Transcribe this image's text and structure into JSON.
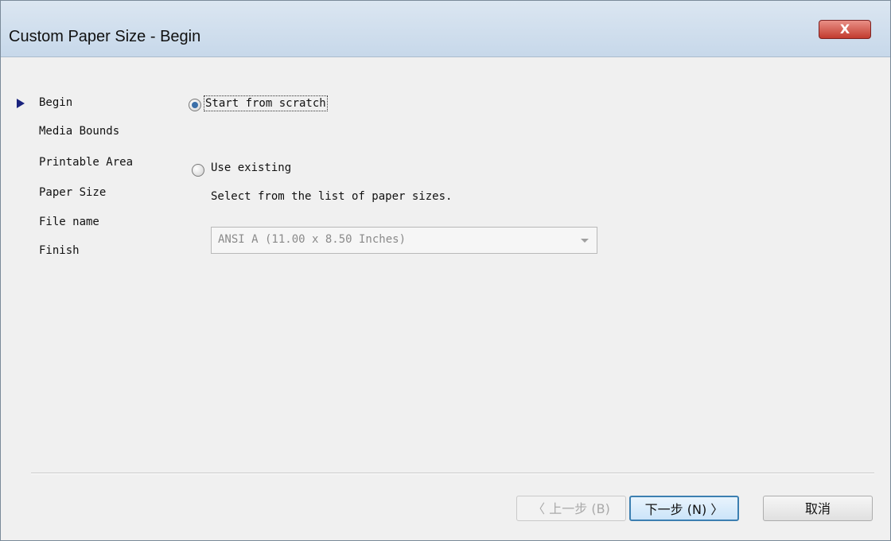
{
  "window": {
    "title": "Custom Paper Size - Begin",
    "close_glyph": "X"
  },
  "steps": [
    {
      "label": "Begin",
      "current": true
    },
    {
      "label": "Media Bounds",
      "current": false
    },
    {
      "label": "Printable Area",
      "current": false
    },
    {
      "label": "Paper Size",
      "current": false
    },
    {
      "label": "File name",
      "current": false
    },
    {
      "label": "Finish",
      "current": false
    }
  ],
  "options": {
    "scratch_label": "Start from scratch",
    "scratch_selected": true,
    "existing_label": "Use existing",
    "existing_selected": false,
    "existing_hint": "Select from the list of paper sizes."
  },
  "paper_combo": {
    "value": "ANSI A (11.00 x 8.50 Inches)",
    "enabled": false
  },
  "buttons": {
    "back": "〈 上一步 (B)",
    "next": "下一步 (N) 〉",
    "cancel": "取消"
  },
  "colors": {
    "accent": "#3c7fb1",
    "close": "#c23b2e",
    "step_arrow": "#1a237e"
  }
}
